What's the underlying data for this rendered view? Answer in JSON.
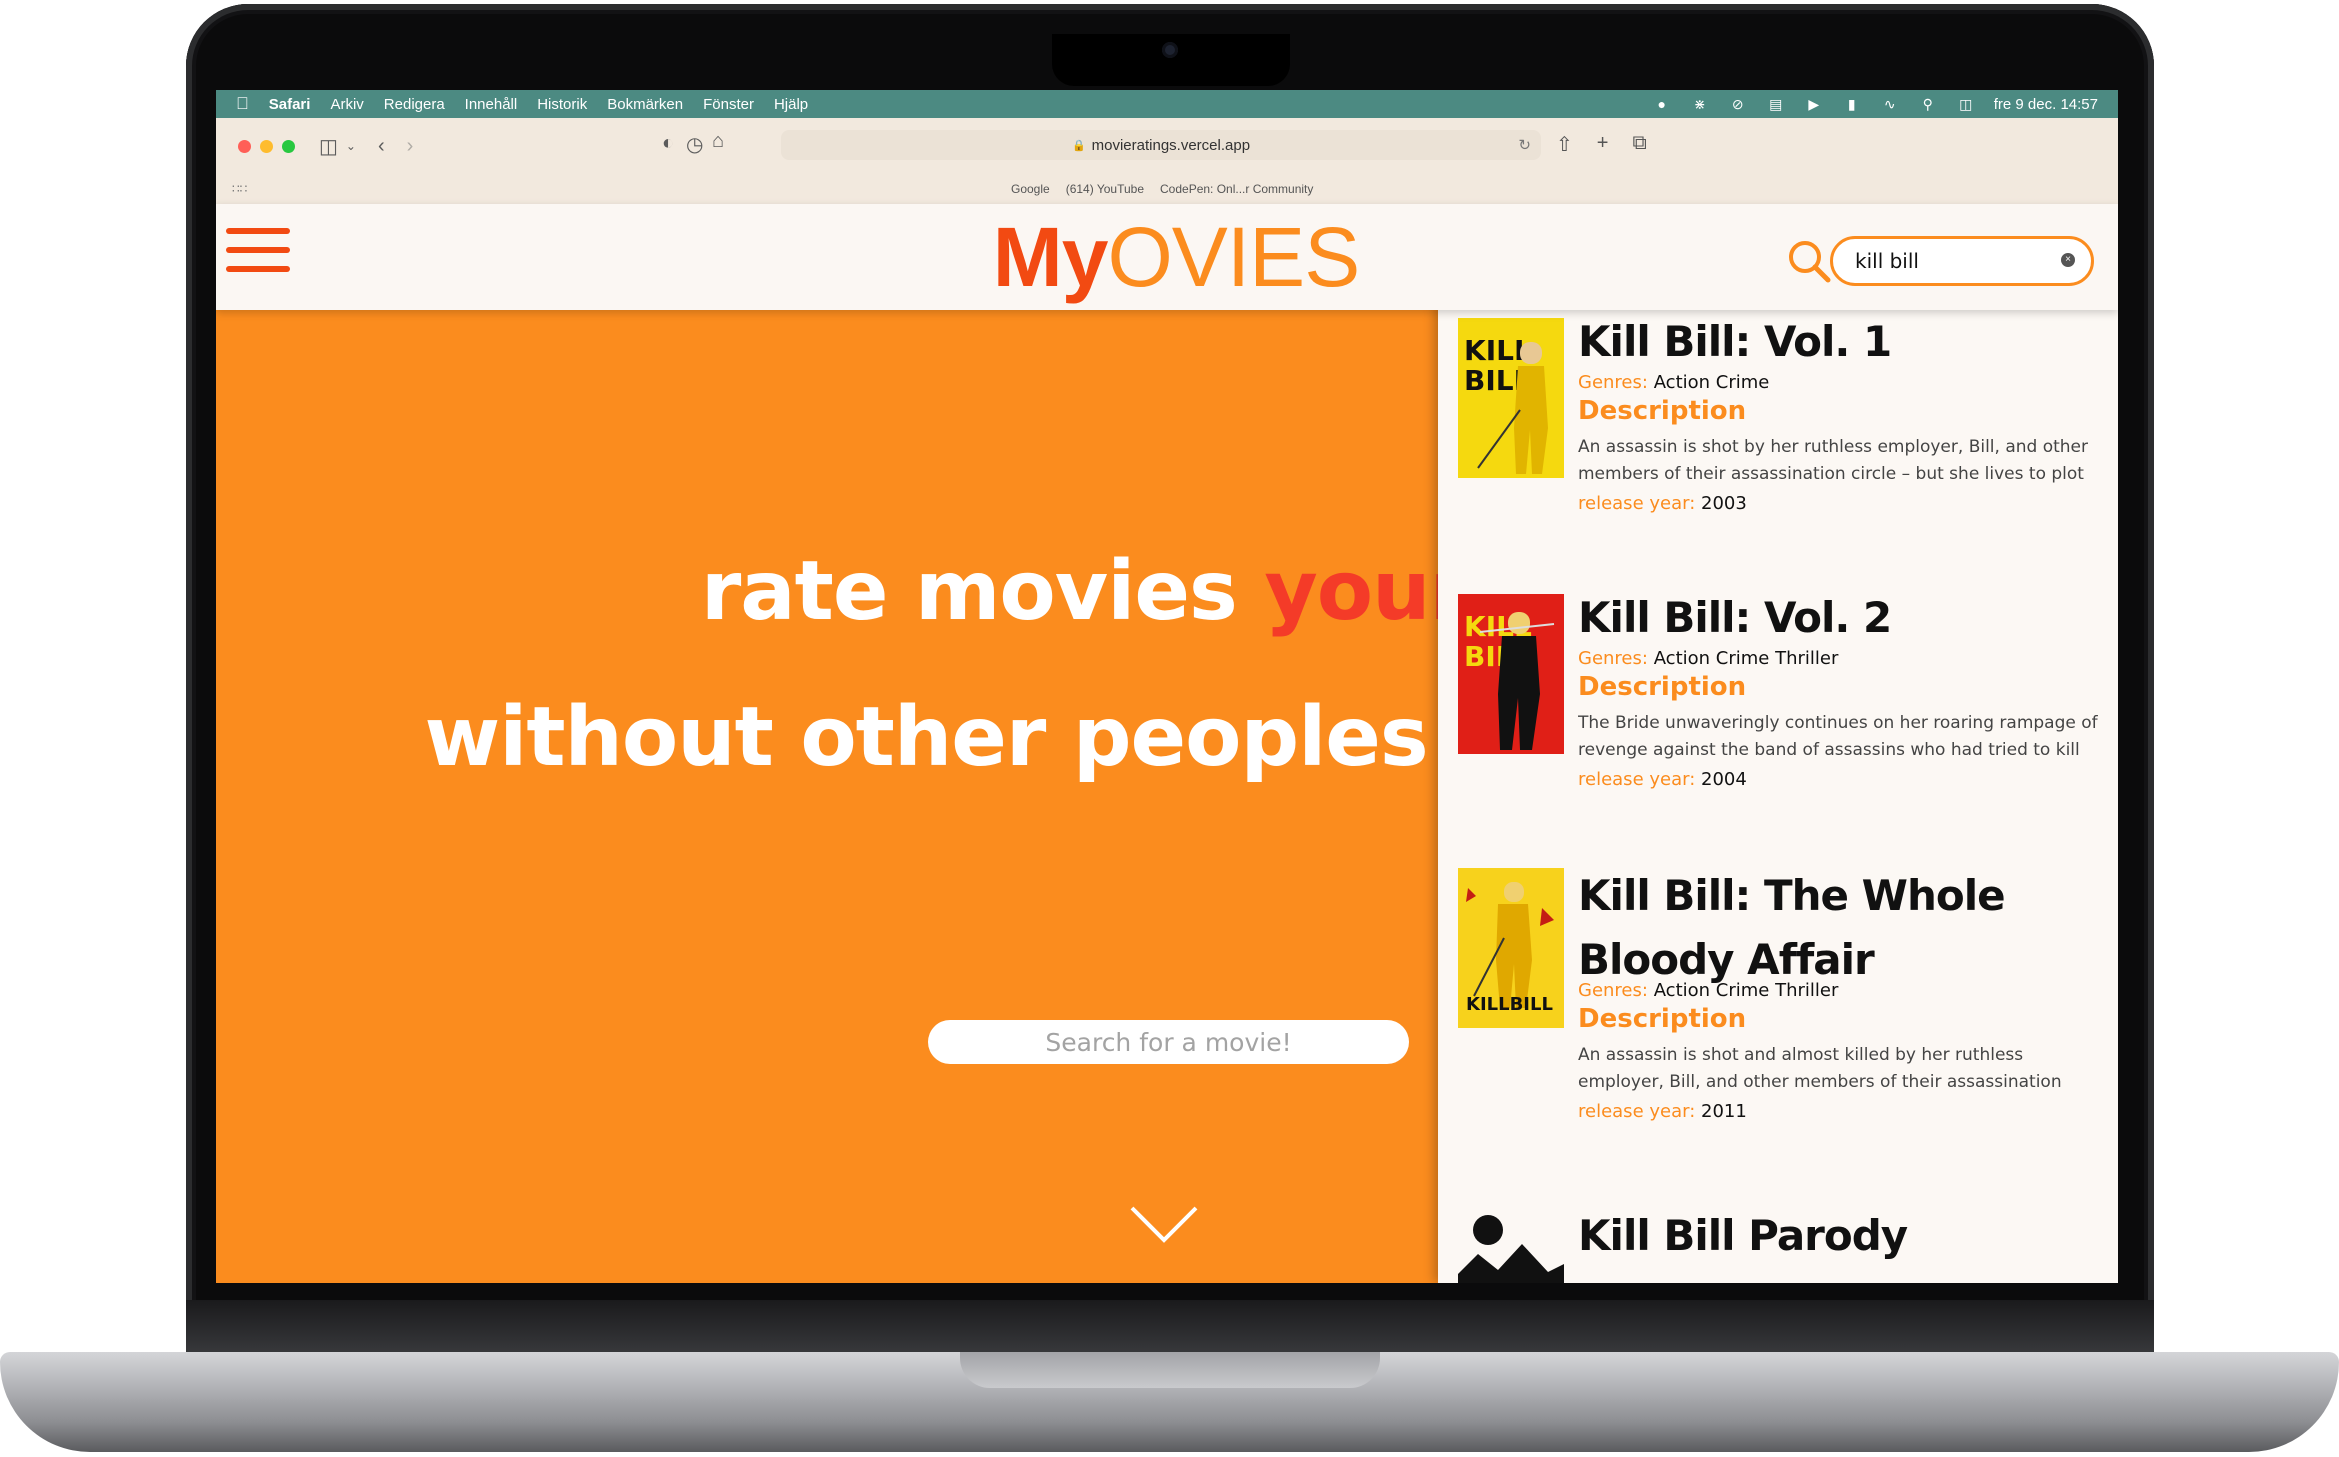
{
  "menubar": {
    "app_name": "Safari",
    "items": [
      "Arkiv",
      "Redigera",
      "Innehåll",
      "Historik",
      "Bokmärken",
      "Fönster",
      "Hjälp"
    ],
    "clock": "fre 9 dec.  14:57"
  },
  "browser": {
    "url": "movieratings.vercel.app",
    "favorites": [
      "Google",
      "(614) YouTube",
      "CodePen: Onl...r Community"
    ]
  },
  "site": {
    "logo_my": "My",
    "logo_ovies": "OVIES",
    "search_value": "kill bill",
    "accent_color": "#fb8c1e",
    "brand_color": "#f24a12"
  },
  "hero": {
    "line1_white": "rate movies ",
    "line1_accent": "yourself",
    "line2": "without other peoples influence!",
    "search_placeholder": "Search for a movie!"
  },
  "labels": {
    "genres": "Genres:",
    "description": "Description",
    "release_year": "release year:"
  },
  "results": [
    {
      "title": "Kill Bill: Vol. 1",
      "genres": "Action Crime",
      "description": "An assassin is shot by her ruthless employer, Bill, and other members of their assassination circle – but she lives to plot",
      "year": "2003",
      "poster_bg": "#f5d90f"
    },
    {
      "title": "Kill Bill: Vol. 2",
      "genres": "Action Crime Thriller",
      "description": "The Bride unwaveringly continues on her roaring rampage of revenge against the band of assassins who had tried to kill",
      "year": "2004",
      "poster_bg": "#e01f17"
    },
    {
      "title": "Kill Bill: The Whole Bloody Affair",
      "genres": "Action Crime Thriller",
      "description": "An assassin is shot and almost killed by her ruthless employer, Bill, and other members of their assassination",
      "year": "2011",
      "poster_bg": "#f7d21c"
    },
    {
      "title": "Kill Bill Parody"
    }
  ]
}
